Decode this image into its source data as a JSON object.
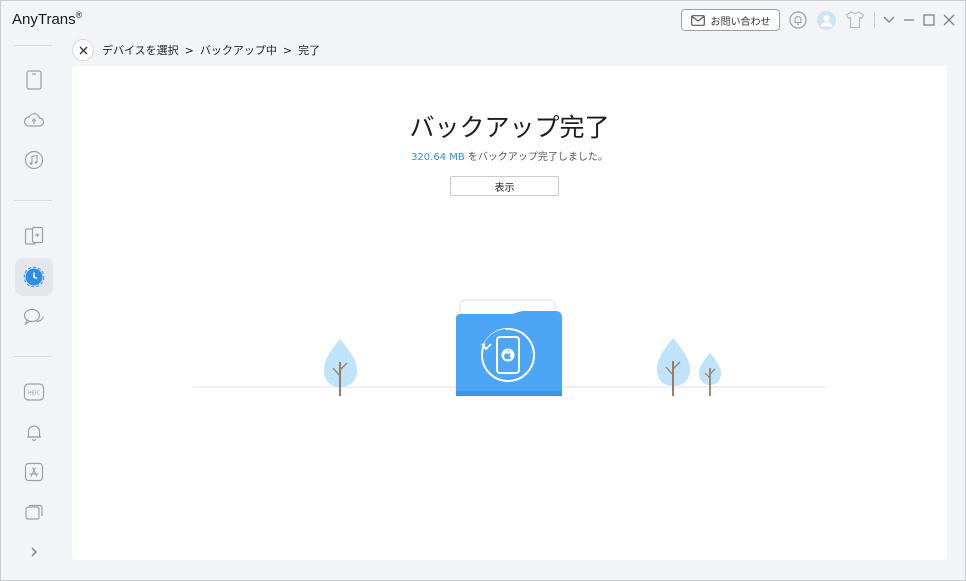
{
  "app": {
    "title": "AnyTrans",
    "registered_mark": "®"
  },
  "titlebar": {
    "contact_label": "お問い合わせ",
    "icons": [
      "mail-icon",
      "bell-icon",
      "user-avatar-icon",
      "tshirt-icon",
      "chevron-down-icon",
      "minimize-icon",
      "maximize-icon",
      "close-icon"
    ]
  },
  "sidebar": {
    "items": [
      {
        "name": "device-icon",
        "active": false
      },
      {
        "name": "cloud-icon",
        "active": false
      },
      {
        "name": "music-icon",
        "active": false
      },
      {
        "name": "phone-switch-icon",
        "active": false
      },
      {
        "name": "backup-icon",
        "active": true
      },
      {
        "name": "messages-icon",
        "active": false
      },
      {
        "name": "heic-icon",
        "label": "HEIC",
        "active": false
      },
      {
        "name": "ringtone-icon",
        "active": false
      },
      {
        "name": "app-store-icon",
        "active": false
      },
      {
        "name": "screen-mirror-icon",
        "active": false
      }
    ],
    "expand_icon": "chevron-right-icon"
  },
  "breadcrumb": {
    "items": [
      "デバイスを選択",
      "バックアップ中",
      "完了"
    ],
    "separator": ">"
  },
  "main": {
    "title": "バックアップ完了",
    "size": "320.64 MB",
    "subtitle_suffix": " をバックアップ完了しました。",
    "view_button": "表示"
  },
  "colors": {
    "accent": "#2d8ee6",
    "folder": "#4da6f5",
    "tree": "#bfe3fb",
    "trunk": "#9b7b62"
  }
}
